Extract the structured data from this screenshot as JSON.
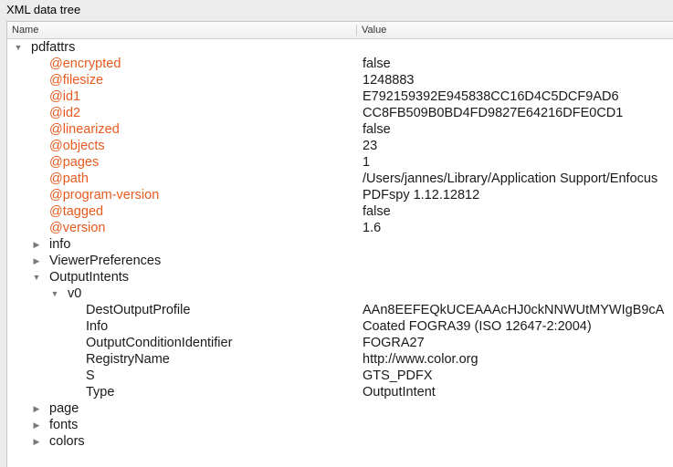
{
  "window": {
    "title": "XML data tree"
  },
  "columns": {
    "name": "Name",
    "value": "Value"
  },
  "tree": {
    "root": {
      "label": "pdfattrs",
      "toggle": "▼"
    },
    "attributes": [
      {
        "name": "@encrypted",
        "value": "false"
      },
      {
        "name": "@filesize",
        "value": "1248883"
      },
      {
        "name": "@id1",
        "value": "E792159392E945838CC16D4C5DCF9AD6"
      },
      {
        "name": "@id2",
        "value": "CC8FB509B0BD4FD9827E64216DFE0CD1"
      },
      {
        "name": "@linearized",
        "value": "false"
      },
      {
        "name": "@objects",
        "value": "23"
      },
      {
        "name": "@pages",
        "value": "1"
      },
      {
        "name": "@path",
        "value": "/Users/jannes/Library/Application Support/Enfocus"
      },
      {
        "name": "@program-version",
        "value": "PDFspy 1.12.12812"
      },
      {
        "name": "@tagged",
        "value": "false"
      },
      {
        "name": "@version",
        "value": "1.6"
      }
    ],
    "info": {
      "label": "info",
      "toggle": "▶"
    },
    "viewer_preferences": {
      "label": "ViewerPreferences",
      "toggle": "▶"
    },
    "output_intents": {
      "label": "OutputIntents",
      "toggle": "▼",
      "v0": {
        "label": "v0",
        "toggle": "▼",
        "children": [
          {
            "name": "DestOutputProfile",
            "value": "AAn8EEFEQkUCEAAAcHJ0ckNNWUtMYWIgB9cA"
          },
          {
            "name": "Info",
            "value": "Coated FOGRA39 (ISO 12647-2:2004)"
          },
          {
            "name": "OutputConditionIdentifier",
            "value": "FOGRA27"
          },
          {
            "name": "RegistryName",
            "value": "http://www.color.org"
          },
          {
            "name": "S",
            "value": "GTS_PDFX"
          },
          {
            "name": "Type",
            "value": "OutputIntent"
          }
        ]
      }
    },
    "page": {
      "label": "page",
      "toggle": "▶"
    },
    "fonts": {
      "label": "fonts",
      "toggle": "▶"
    },
    "colors": {
      "label": "colors",
      "toggle": "▶"
    }
  },
  "colors": {
    "attribute_text": "#e85a1f",
    "background": "#ececec",
    "panel": "#ffffff"
  }
}
